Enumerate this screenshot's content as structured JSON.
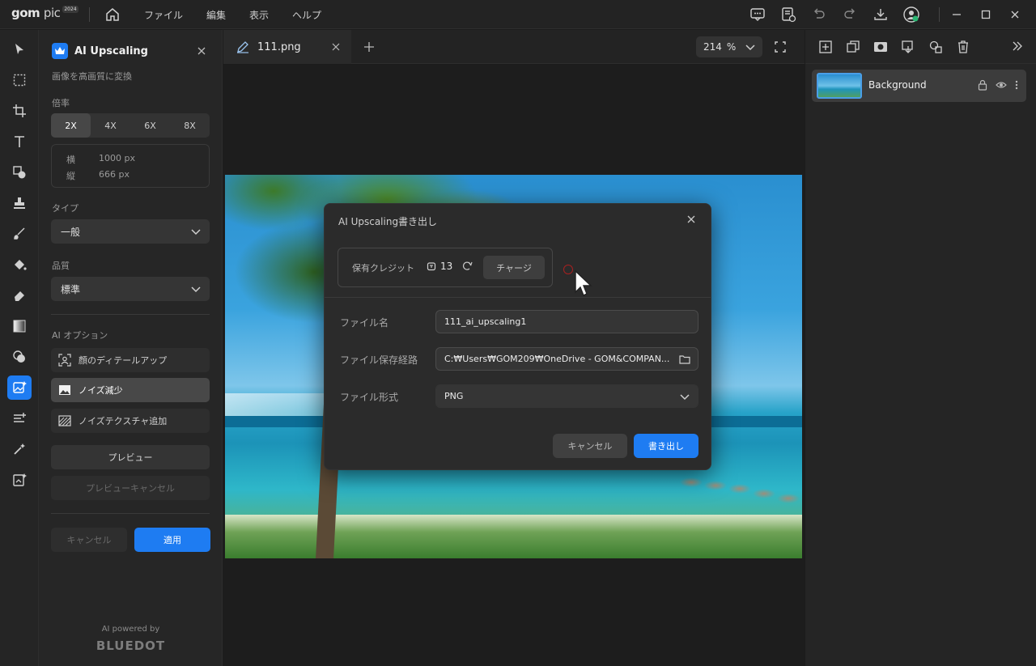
{
  "app": {
    "logo": "gom",
    "logo_light": "pic",
    "logo_badge": "2024"
  },
  "menu": [
    {
      "label": "ファイル"
    },
    {
      "label": "編集"
    },
    {
      "label": "表示"
    },
    {
      "label": "ヘルプ"
    }
  ],
  "panel": {
    "title": "AI Upscaling",
    "subtitle": "画像を高画質に変換",
    "scale_label": "倍率",
    "scales": [
      "2X",
      "4X",
      "6X",
      "8X"
    ],
    "selected_scale": "2X",
    "width_label": "横",
    "width_value": "1000 px",
    "height_label": "縦",
    "height_value": "666  px",
    "type_label": "タイプ",
    "type_value": "一般",
    "quality_label": "品質",
    "quality_value": "標準",
    "ai_options_label": "AI オプション",
    "options": [
      {
        "label": "顔のディテールアップ",
        "selected": false
      },
      {
        "label": "ノイズ減少",
        "selected": true
      },
      {
        "label": "ノイズテクスチャ追加",
        "selected": false
      }
    ],
    "preview_label": "プレビュー",
    "preview_cancel_label": "プレビューキャンセル",
    "cancel_label": "キャンセル",
    "apply_label": "適用",
    "powered_by": "AI powered by",
    "brand": "BLUEDOT"
  },
  "tab": {
    "filename": "111.png"
  },
  "zoom": {
    "value": "214",
    "unit": "%"
  },
  "layers": [
    {
      "name": "Background"
    }
  ],
  "dialog": {
    "title": "AI Upscaling書き出し",
    "credit_label": "保有クレジット",
    "credit_count": "13",
    "charge_label": "チャージ",
    "filename_label": "ファイル名",
    "filename_value": "111_ai_upscaling1",
    "path_label": "ファイル保存経路",
    "path_value": "C:₩Users₩GOM209₩OneDrive - GOM&COMPAN...",
    "format_label": "ファイル形式",
    "format_value": "PNG",
    "cancel_label": "キャンセル",
    "export_label": "書き出し"
  },
  "colors": {
    "accent": "#1e7cf2",
    "background": "#1c1c1c",
    "panel": "#262626"
  }
}
